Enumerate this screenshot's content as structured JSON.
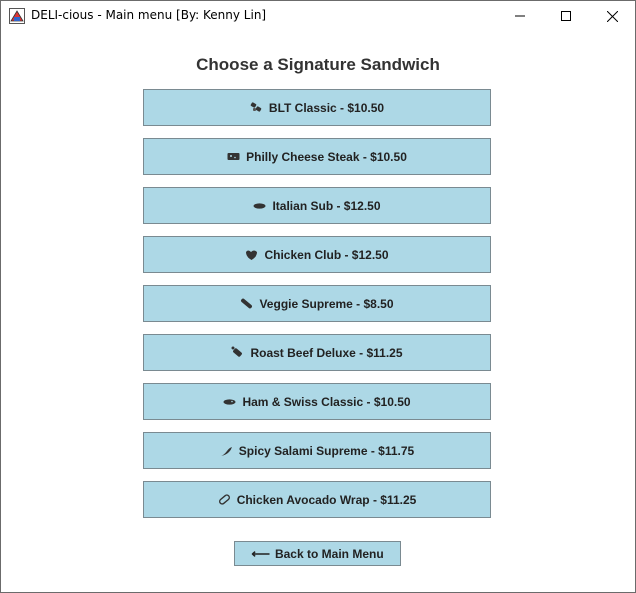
{
  "window": {
    "title": "DELI-cious - Main menu [By: Kenny Lin]"
  },
  "heading": "Choose a Signature Sandwich",
  "sandwiches": [
    {
      "label": "BLT Classic - $10.50",
      "icon": "bacon-icon"
    },
    {
      "label": "Philly Cheese Steak - $10.50",
      "icon": "cheese-icon"
    },
    {
      "label": "Italian Sub - $12.50",
      "icon": "sub-roll-icon"
    },
    {
      "label": "Chicken Club - $12.50",
      "icon": "chicken-icon"
    },
    {
      "label": "Veggie Supreme - $8.50",
      "icon": "cucumber-icon"
    },
    {
      "label": "Roast Beef Deluxe - $11.25",
      "icon": "meat-icon"
    },
    {
      "label": "Ham & Swiss Classic - $10.50",
      "icon": "ham-icon"
    },
    {
      "label": "Spicy Salami Supreme - $11.75",
      "icon": "chili-icon"
    },
    {
      "label": "Chicken Avocado Wrap - $11.25",
      "icon": "wrap-icon"
    }
  ],
  "back": {
    "label": "Back to Main Menu",
    "icon": "left-arrow-icon"
  },
  "colors": {
    "button_bg": "#add8e6",
    "text": "#222222"
  }
}
